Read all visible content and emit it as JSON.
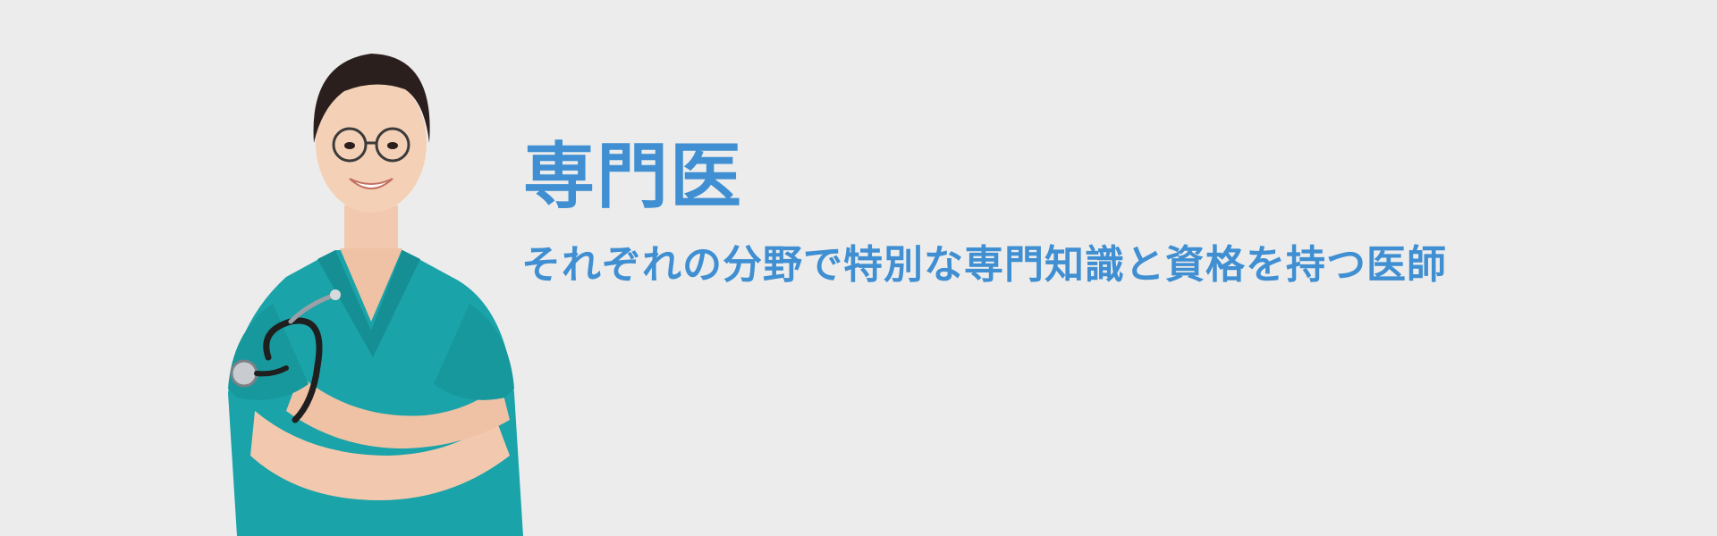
{
  "banner": {
    "title": "専門医",
    "subtitle": "それぞれの分野で特別な専門知識と資格を持つ医師",
    "accent_color": "#3f8fd2",
    "background_color": "#ececec"
  },
  "image": {
    "icon": "doctor-portrait-illustration",
    "scrub_color": "#1aa3a8"
  }
}
